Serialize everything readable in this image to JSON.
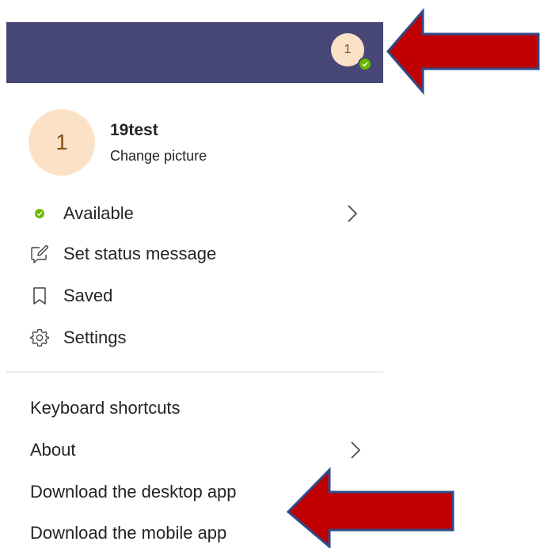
{
  "header": {
    "avatar_initial": "1",
    "bar_color": "#464775",
    "presence": "available-check-icon"
  },
  "profile": {
    "avatar_initial": "1",
    "name": "19test",
    "change_picture": "Change picture"
  },
  "menu": {
    "available": "Available",
    "set_status": "Set status message",
    "saved": "Saved",
    "settings": "Settings"
  },
  "secondary_menu": {
    "keyboard_shortcuts": "Keyboard shortcuts",
    "about": "About",
    "download_desktop": "Download the desktop app",
    "download_mobile": "Download the mobile app"
  },
  "colors": {
    "available_green": "#6bb700",
    "avatar_bg": "#fbe2c7",
    "avatar_text": "#8a4e14",
    "annotation_arrow": "#c00000",
    "annotation_arrow_border": "#2f4a8a"
  },
  "icons": {
    "available": "status-dot-icon",
    "set_status": "edit-message-icon",
    "saved": "bookmark-icon",
    "settings": "gear-icon",
    "submenu": "chevron-right-icon"
  }
}
